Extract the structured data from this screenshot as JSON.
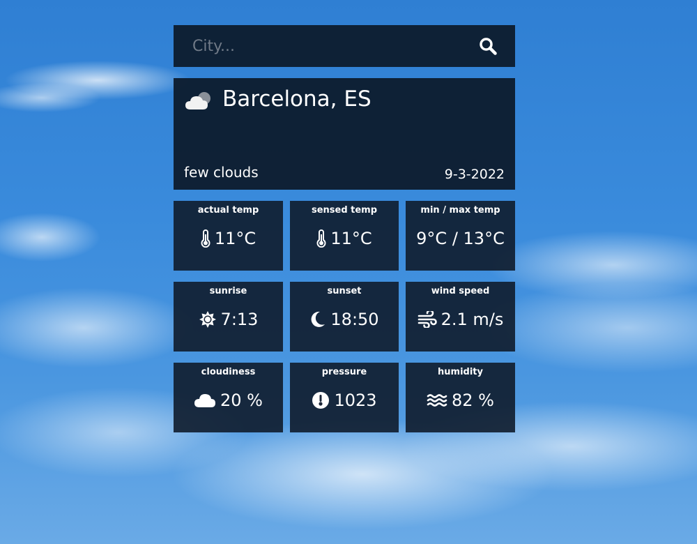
{
  "search": {
    "placeholder": "City...",
    "icon": "search-icon"
  },
  "current": {
    "icon": "few-clouds-icon",
    "city": "Barcelona, ES",
    "description": "few clouds",
    "date": "9-3-2022"
  },
  "tiles": [
    {
      "label": "actual temp",
      "value": "11°C",
      "icon": "thermometer-icon"
    },
    {
      "label": "sensed temp",
      "value": "11°C",
      "icon": "thermometer-icon"
    },
    {
      "label": "min / max temp",
      "value": "9°C / 13°C",
      "icon": ""
    },
    {
      "label": "sunrise",
      "value": "7:13",
      "icon": "sun-icon"
    },
    {
      "label": "sunset",
      "value": "18:50",
      "icon": "moon-icon"
    },
    {
      "label": "wind speed",
      "value": "2.1 m/s",
      "icon": "wind-icon"
    },
    {
      "label": "cloudiness",
      "value": "20 %",
      "icon": "cloud-icon"
    },
    {
      "label": "pressure",
      "value": "1023",
      "icon": "pressure-gauge-icon"
    },
    {
      "label": "humidity",
      "value": "82 %",
      "icon": "water-waves-icon"
    }
  ],
  "colors": {
    "panel": "#0d1b2d",
    "text": "#ffffff",
    "placeholder": "#707a87",
    "sky": "#3a8bdc"
  }
}
